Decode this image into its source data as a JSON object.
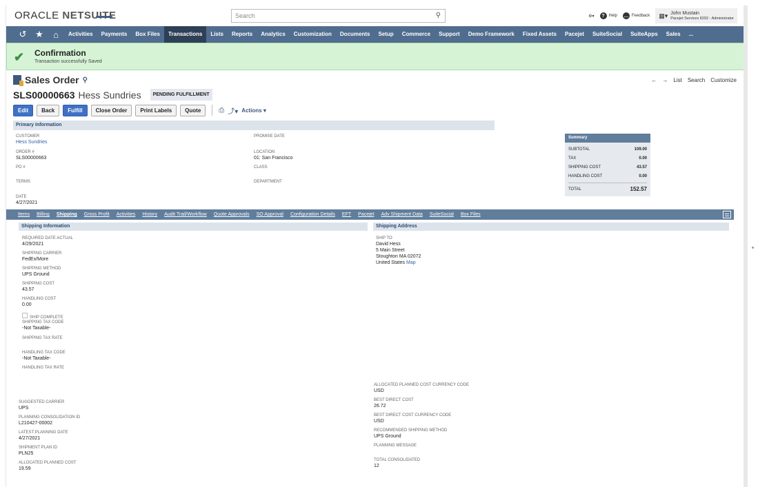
{
  "app": {
    "logo_main": "ORACLE ",
    "logo_brand": "NETSUITE",
    "search_placeholder": "Search"
  },
  "topright": {
    "help": "Help",
    "feedback": "Feedback",
    "user_name": "John Mustain",
    "user_role": "Pacejet Services 8292 - Administrator"
  },
  "nav": {
    "items": [
      "Activities",
      "Payments",
      "Box Files",
      "Transactions",
      "Lists",
      "Reports",
      "Analytics",
      "Customization",
      "Documents",
      "Setup",
      "Commerce",
      "Support",
      "Demo Framework",
      "Fixed Assets",
      "Pacejet",
      "SuiteSocial",
      "SuiteApps",
      "Sales",
      "..."
    ],
    "active": "Transactions"
  },
  "confirmation": {
    "title": "Confirmation",
    "message": "Transaction successfully Saved"
  },
  "record": {
    "type": "Sales Order",
    "number": "SLS00000663",
    "customer": "Hess Sundries",
    "status": "PENDING FULFILLMENT",
    "nav_list": "List",
    "nav_search": "Search",
    "nav_customize": "Customize"
  },
  "buttons": {
    "edit": "Edit",
    "back": "Back",
    "fulfill": "Fulfill",
    "close_order": "Close Order",
    "print_labels": "Print Labels",
    "quote": "Quote",
    "actions": "Actions"
  },
  "primary": {
    "section_title": "Primary Information",
    "customer_label": "CUSTOMER",
    "customer_value": "Hess Sundries",
    "order_label": "ORDER #",
    "order_value": "SLS00000663",
    "po_label": "PO #",
    "terms_label": "TERMS",
    "date_label": "DATE",
    "date_value": "4/27/2021",
    "promise_label": "PROMISE DATE",
    "location_label": "LOCATION",
    "location_value": "01: San Francisco",
    "class_label": "CLASS",
    "department_label": "DEPARTMENT"
  },
  "summary": {
    "title": "Summary",
    "subtotal_label": "SUBTOTAL",
    "subtotal": "109.00",
    "tax_label": "TAX",
    "tax": "0.00",
    "shipping_label": "SHIPPING COST",
    "shipping": "43.57",
    "handling_label": "HANDLING COST",
    "handling": "0.00",
    "total_label": "TOTAL",
    "total": "152.57"
  },
  "subtabs": [
    "Items",
    "Billing",
    "Shipping",
    "Gross Profit",
    "Activities",
    "History",
    "Audit Trail/Workflow",
    "Quote Approvals",
    "SO Approval",
    "Configuration Details",
    "EFT",
    "Pacejet",
    "Adv Shipment Data",
    "SuiteSocial",
    "Box Files"
  ],
  "shipping": {
    "info_title": "Shipping Information",
    "address_title": "Shipping Address",
    "required_date_label": "REQUIRED DATE  ACTUAL",
    "required_date": "4/29/2021",
    "carrier_label": "SHIPPING CARRIER",
    "carrier": "FedEx/More",
    "method_label": "SHIPPING METHOD",
    "method": "UPS Ground",
    "cost_label": "SHIPPING COST",
    "cost": "43.57",
    "handling_label": "HANDLING COST",
    "handling": "0.00",
    "ship_complete_label": "SHIP COMPLETE",
    "tax_code_label": "SHIPPING TAX CODE",
    "tax_code": "-Not Taxable-",
    "tax_rate_label": "SHIPPING TAX RATE",
    "handling_tax_code_label": "HANDLING TAX CODE",
    "handling_tax_code": "-Not Taxable-",
    "handling_tax_rate_label": "HANDLING TAX RATE",
    "ship_to_label": "SHIP TO",
    "ship_to_lines": [
      "David Hess",
      "5 Main Street",
      "Stoughton MA 02072",
      "United States"
    ],
    "map_link": "Map",
    "suggested_carrier_label": "SUGGESTED CARRIER",
    "suggested_carrier": "UPS",
    "consolidation_label": "PLANNING CONSOLIDATION ID",
    "consolidation": "L210427-00002",
    "latest_planning_label": "LATEST PLANNING DATE",
    "latest_planning": "4/27/2021",
    "plan_id_label": "SHIPMENT PLAN ID",
    "plan_id": "PLN25",
    "alloc_cost_label": "ALLOCATED PLANNED COST",
    "alloc_cost": "19.59",
    "alloc_currency_label": "ALLOCATED PLANNED COST CURRENCY CODE",
    "alloc_currency": "USD",
    "best_cost_label": "BEST DIRECT COST",
    "best_cost": "26.72",
    "best_currency_label": "BEST DIRECT COST CURRENCY CODE",
    "best_currency": "USD",
    "rec_method_label": "RECOMMENDED SHIPPING METHOD",
    "rec_method": "UPS Ground",
    "planning_msg_label": "PLANNING MESSAGE",
    "total_consolidated_label": "TOTAL CONSOLIDATED",
    "total_consolidated": "12"
  }
}
